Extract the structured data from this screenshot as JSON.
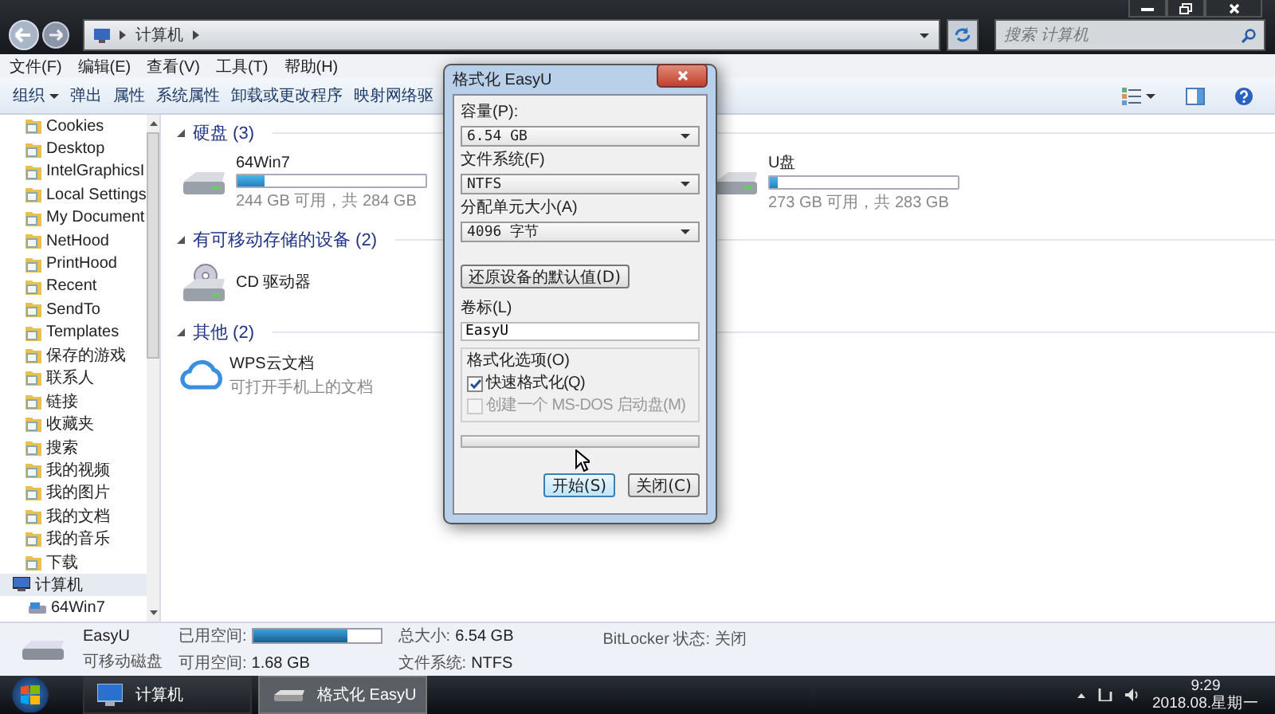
{
  "window": {
    "breadcrumb": [
      "计算机"
    ],
    "search": {
      "placeholder": "搜索 计算机"
    }
  },
  "menu": [
    "文件(F)",
    "编辑(E)",
    "查看(V)",
    "工具(T)",
    "帮助(H)"
  ],
  "toolbar": [
    {
      "label": "组织",
      "dropdown": true
    },
    {
      "label": "弹出",
      "dropdown": false
    },
    {
      "label": "属性",
      "dropdown": false
    },
    {
      "label": "系统属性",
      "dropdown": false
    },
    {
      "label": "卸载或更改程序",
      "dropdown": false
    },
    {
      "label": "映射网络驱",
      "dropdown": false
    }
  ],
  "sidebar": {
    "items": [
      {
        "label": "Cookies",
        "selected": false
      },
      {
        "label": "Desktop",
        "selected": false
      },
      {
        "label": "IntelGraphicsI",
        "selected": false
      },
      {
        "label": "Local Settings",
        "selected": false
      },
      {
        "label": "My Document",
        "selected": false
      },
      {
        "label": "NetHood",
        "selected": false
      },
      {
        "label": "PrintHood",
        "selected": false
      },
      {
        "label": "Recent",
        "selected": false
      },
      {
        "label": "SendTo",
        "selected": false
      },
      {
        "label": "Templates",
        "selected": false
      },
      {
        "label": "保存的游戏",
        "selected": false
      },
      {
        "label": "联系人",
        "selected": false
      },
      {
        "label": "链接",
        "selected": false
      },
      {
        "label": "收藏夹",
        "selected": false
      },
      {
        "label": "搜索",
        "selected": false
      },
      {
        "label": "我的视频",
        "selected": false
      },
      {
        "label": "我的图片",
        "selected": false
      },
      {
        "label": "我的文档",
        "selected": false
      },
      {
        "label": "我的音乐",
        "selected": false
      },
      {
        "label": "下载",
        "selected": false
      },
      {
        "label": "计算机",
        "selected": true,
        "children": [
          {
            "label": "64Win7",
            "selected": false
          }
        ]
      }
    ]
  },
  "sections": [
    {
      "title": "硬盘 (3)",
      "items": [
        {
          "kind": "drive",
          "name": "64Win7",
          "level": 0.14,
          "detail": "244 GB 可用，共 284 GB"
        },
        {
          "kind": "hidden"
        },
        {
          "kind": "drive",
          "name": "U盘",
          "level": 0.04,
          "detail": "273 GB 可用，共 283 GB"
        }
      ]
    },
    {
      "title": "有可移动存储的设备 (2)",
      "items": [
        {
          "kind": "cd",
          "name": "CD 驱动器"
        },
        {
          "kind": "hidden"
        }
      ]
    },
    {
      "title": "其他 (2)",
      "items": [
        {
          "kind": "cloud",
          "name": "WPS云文档",
          "detail": "可打开手机上的文档"
        },
        {
          "kind": "hidden"
        }
      ]
    }
  ],
  "details": {
    "name": "EasyU",
    "type": "可移动磁盘",
    "used_label": "已用空间:",
    "level": 0.74,
    "free_label": "可用空间:",
    "free": "1.68 GB",
    "total_label": "总大小:",
    "total": "6.54 GB",
    "fs_label": "文件系统:",
    "fs": "NTFS",
    "bitlocker": "BitLocker 状态: 关闭"
  },
  "dialog": {
    "title": "格式化 EasyU",
    "fields": [
      {
        "label": "容量(P):",
        "value": "6.54 GB"
      },
      {
        "label": "文件系统(F)",
        "value": "NTFS"
      },
      {
        "label": "分配单元大小(A)",
        "value": "4096 字节"
      }
    ],
    "restore_button": "还原设备的默认值(D)",
    "volume_label": "卷标(L)",
    "volume_value": "EasyU",
    "options_title": "格式化选项(O)",
    "options": [
      {
        "label": "快速格式化(Q)",
        "checked": true,
        "disabled": false
      },
      {
        "label": "创建一个 MS-DOS 启动盘(M)",
        "checked": false,
        "disabled": true
      }
    ],
    "progress": {
      "level": 0
    },
    "buttons": [
      {
        "label": "开始(S)",
        "focused": true
      },
      {
        "label": "关闭(C)",
        "focused": false
      }
    ]
  },
  "taskbar": {
    "items": [
      {
        "label": "计算机",
        "selected": false,
        "kind": "computer"
      },
      {
        "label": "格式化 EasyU",
        "selected": true,
        "kind": "drive"
      }
    ],
    "time": "9:29",
    "date": "2018.08.星期一"
  }
}
